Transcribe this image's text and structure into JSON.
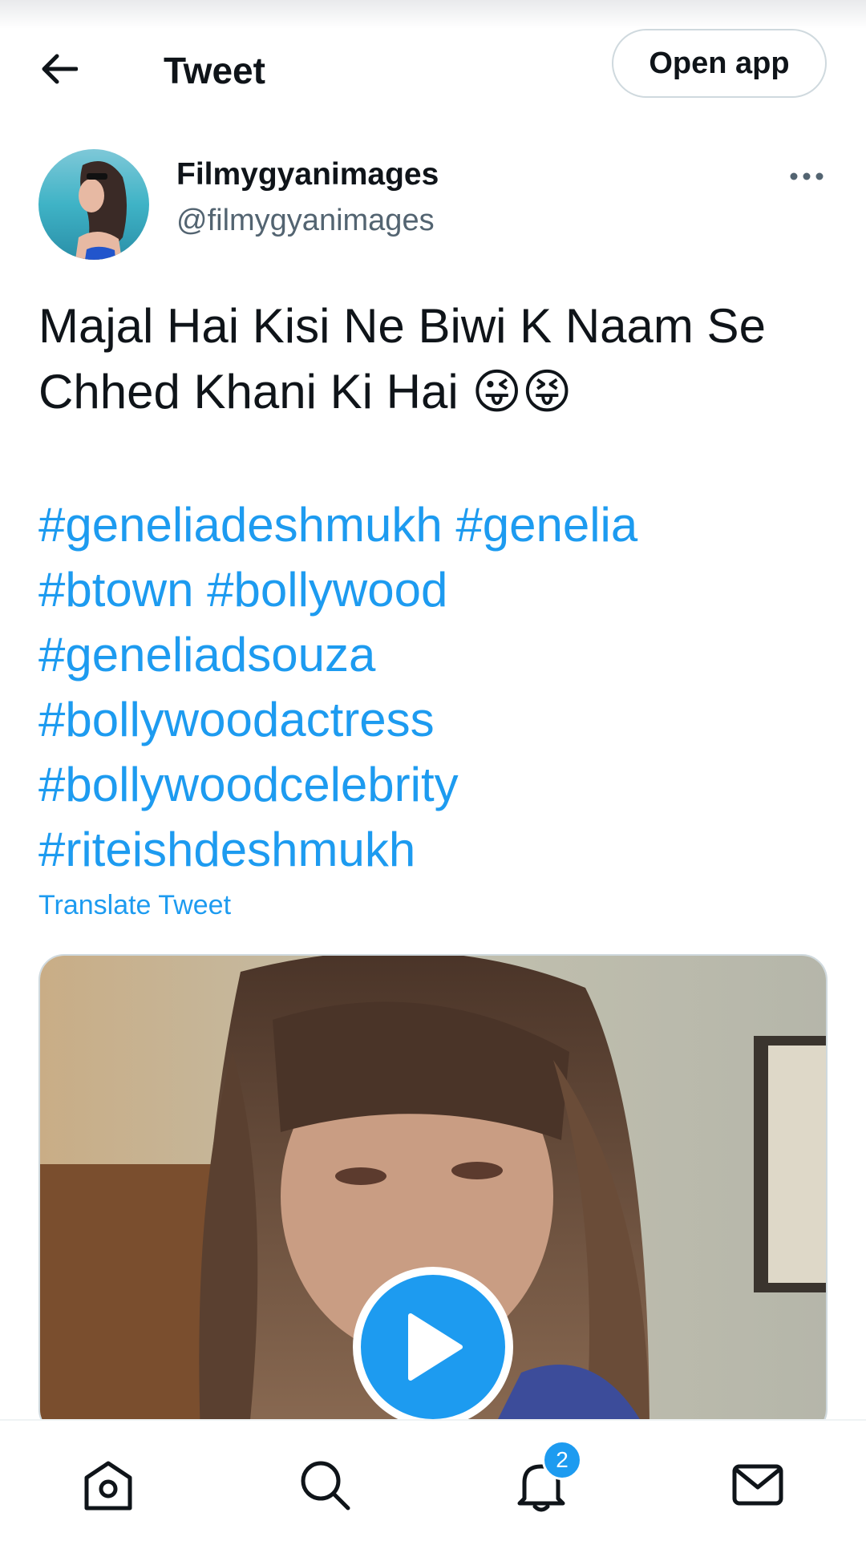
{
  "header": {
    "title": "Tweet",
    "open_app_label": "Open app"
  },
  "author": {
    "name": "Filmygyanimages",
    "handle": "@filmygyanimages"
  },
  "tweet": {
    "text": "Majal Hai Kisi Ne Biwi K Naam Se Chhed Khani Ki Hai 😜😝",
    "hashtag_lines": [
      [
        "#geneliadeshmukh",
        "#genelia"
      ],
      [
        "#btown",
        "#bollywood"
      ],
      [
        "#geneliadsouza"
      ],
      [
        "#bollywoodactress"
      ],
      [
        "#bollywoodcelebrity"
      ],
      [
        "#riteishdeshmukh"
      ]
    ],
    "translate_label": "Translate Tweet"
  },
  "media": {
    "type": "video"
  },
  "bottom_nav": {
    "items": [
      "home-icon",
      "search-icon",
      "notifications-icon",
      "messages-icon"
    ],
    "notifications_badge": "2"
  },
  "colors": {
    "accent": "#1d9bf0",
    "text": "#0f1419",
    "secondary_text": "#536471",
    "border": "#cfd9de"
  }
}
